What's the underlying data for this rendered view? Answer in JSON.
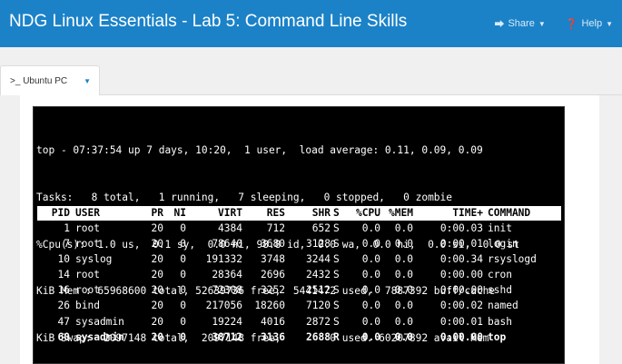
{
  "app": {
    "title": "NDG Linux Essentials - Lab 5: Command Line Skills",
    "share_label": "Share",
    "help_label": "Help"
  },
  "tab": {
    "prompt_icon": ">_",
    "label": "Ubuntu PC"
  },
  "terminal": {
    "summary": [
      "top - 07:37:54 up 7 days, 10:20,  1 user,  load average: 0.11, 0.09, 0.09",
      "Tasks:   8 total,   1 running,   7 sleeping,   0 stopped,   0 zombie",
      "%Cpu(s):  1.0 us,  0.1 sy,  0.0 ni, 98.8 id,  0.0 wa,  0.0 hi,  0.0 si,  0.0 st",
      "KiB Mem : 65968600 total, 52639736 free,  5441472 used,  7887392 buff/cache",
      "KiB Swap:  2097148 total,  2097148 free,        0 used. 60207892 avail Mem"
    ],
    "columns": [
      "PID",
      "USER",
      "PR",
      "NI",
      "VIRT",
      "RES",
      "SHR",
      "S",
      "%CPU",
      "%MEM",
      "TIME+",
      "COMMAND"
    ],
    "processes": [
      {
        "pid": "1",
        "user": "root",
        "pr": "20",
        "ni": "0",
        "virt": "4384",
        "res": "712",
        "shr": "652",
        "s": "S",
        "cpu": "0.0",
        "mem": "0.0",
        "time": "0:00.03",
        "cmd": "init"
      },
      {
        "pid": "7",
        "user": "root",
        "pr": "20",
        "ni": "0",
        "virt": "78640",
        "res": "3680",
        "shr": "3128",
        "s": "S",
        "cpu": "0.0",
        "mem": "0.0",
        "time": "0:00.01",
        "cmd": "login"
      },
      {
        "pid": "10",
        "user": "syslog",
        "pr": "20",
        "ni": "0",
        "virt": "191332",
        "res": "3748",
        "shr": "3244",
        "s": "S",
        "cpu": "0.0",
        "mem": "0.0",
        "time": "0:00.34",
        "cmd": "rsyslogd"
      },
      {
        "pid": "14",
        "user": "root",
        "pr": "20",
        "ni": "0",
        "virt": "28364",
        "res": "2696",
        "shr": "2432",
        "s": "S",
        "cpu": "0.0",
        "mem": "0.0",
        "time": "0:00.00",
        "cmd": "cron"
      },
      {
        "pid": "16",
        "user": "root",
        "pr": "20",
        "ni": "0",
        "virt": "72308",
        "res": "3252",
        "shr": "2512",
        "s": "S",
        "cpu": "0.0",
        "mem": "0.0",
        "time": "0:00.00",
        "cmd": "sshd"
      },
      {
        "pid": "26",
        "user": "bind",
        "pr": "20",
        "ni": "0",
        "virt": "217056",
        "res": "18260",
        "shr": "7120",
        "s": "S",
        "cpu": "0.0",
        "mem": "0.0",
        "time": "0:00.02",
        "cmd": "named"
      },
      {
        "pid": "47",
        "user": "sysadmin",
        "pr": "20",
        "ni": "0",
        "virt": "19224",
        "res": "4016",
        "shr": "2872",
        "s": "S",
        "cpu": "0.0",
        "mem": "0.0",
        "time": "0:00.01",
        "cmd": "bash"
      },
      {
        "pid": "60",
        "user": "sysadmin",
        "pr": "20",
        "ni": "0",
        "virt": "38712",
        "res": "3136",
        "shr": "2688",
        "s": "R",
        "cpu": "0.0",
        "mem": "0.0",
        "time": "0:00.00",
        "cmd": "top",
        "highlight": true
      }
    ]
  }
}
